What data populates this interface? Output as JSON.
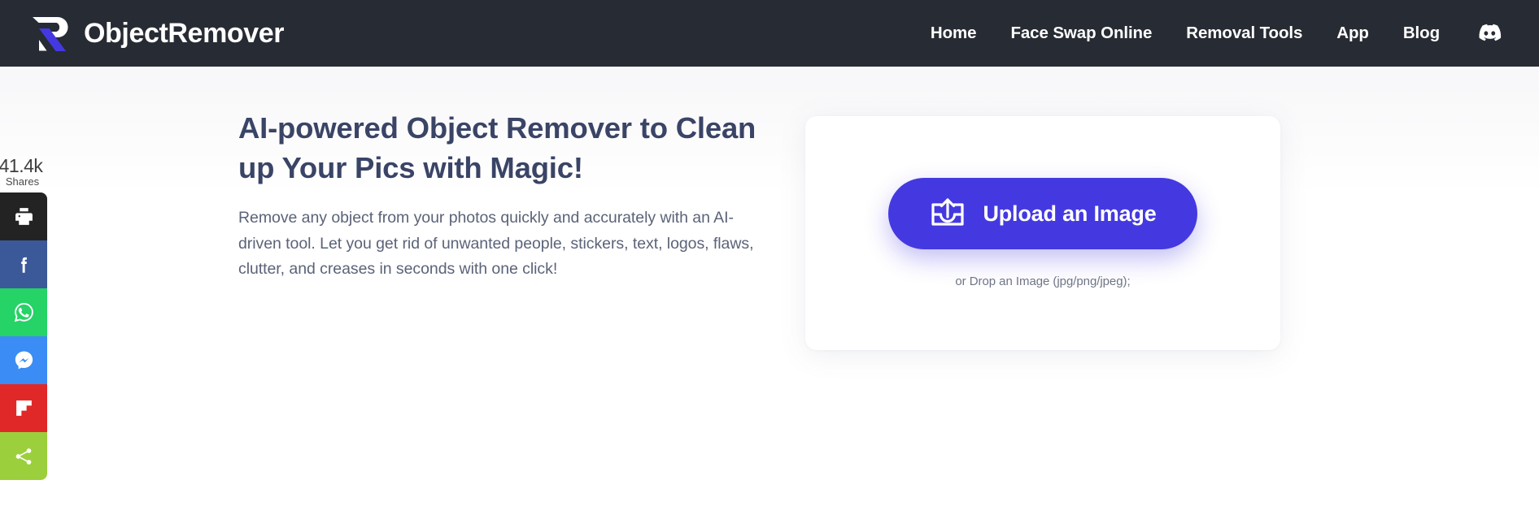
{
  "header": {
    "brand": {
      "logo_icon": "objectremover-r-logo-icon",
      "name": "ObjectRemover"
    },
    "nav": [
      {
        "label": "Home"
      },
      {
        "label": "Face Swap Online"
      },
      {
        "label": "Removal Tools"
      },
      {
        "label": "App"
      },
      {
        "label": "Blog"
      }
    ],
    "social": {
      "icon": "discord-icon"
    },
    "background_color": "#272b33",
    "text_color": "#ffffff"
  },
  "hero": {
    "title": "AI-powered Object Remover to Clean up Your Pics with Magic!",
    "description": "Remove any object from your photos quickly and accurately with an AI-driven tool. Let you get rid of unwanted people, stickers, text, logos, flaws, clutter, and creases in seconds with one click!",
    "title_color": "#3a4466",
    "description_color": "#5b6378"
  },
  "upload": {
    "button_label": "Upload an Image",
    "button_icon": "upload-tray-arrow-icon",
    "button_color": "#4439e0",
    "drop_hint": "or Drop an Image (jpg/png/jpeg);"
  },
  "share_rail": {
    "count": "41.4k",
    "count_label": "Shares",
    "buttons": [
      {
        "name": "print",
        "icon": "printer-icon",
        "color": "#232323"
      },
      {
        "name": "facebook",
        "icon": "facebook-icon",
        "color": "#3b5998"
      },
      {
        "name": "whatsapp",
        "icon": "whatsapp-icon",
        "color": "#25d366"
      },
      {
        "name": "messenger",
        "icon": "messenger-icon",
        "color": "#3b8cf4"
      },
      {
        "name": "flipboard",
        "icon": "flipboard-icon",
        "color": "#e12828"
      },
      {
        "name": "share",
        "icon": "share-nodes-icon",
        "color": "#9ccf3c"
      }
    ]
  }
}
